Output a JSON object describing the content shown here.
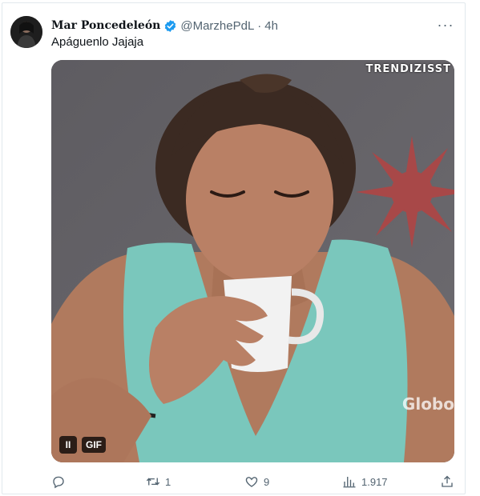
{
  "tweet": {
    "display_name": "Mar Poncedeleón",
    "handle": "@MarzhePdL",
    "separator": "·",
    "time": "4h",
    "text": "Apáguenlo Jajaja",
    "more_label": "···",
    "verified": true
  },
  "media": {
    "watermark": "TRENDIZISST",
    "broadcast_logo": "Globo",
    "gif_badge": "GIF",
    "pause_label": "II"
  },
  "actions": {
    "reply_count": "",
    "retweet_count": "1",
    "like_count": "9",
    "views_count": "1.917"
  },
  "colors": {
    "verified": "#1d9bf0",
    "secondary_text": "#536471",
    "shirt": "#7ac7bc"
  }
}
